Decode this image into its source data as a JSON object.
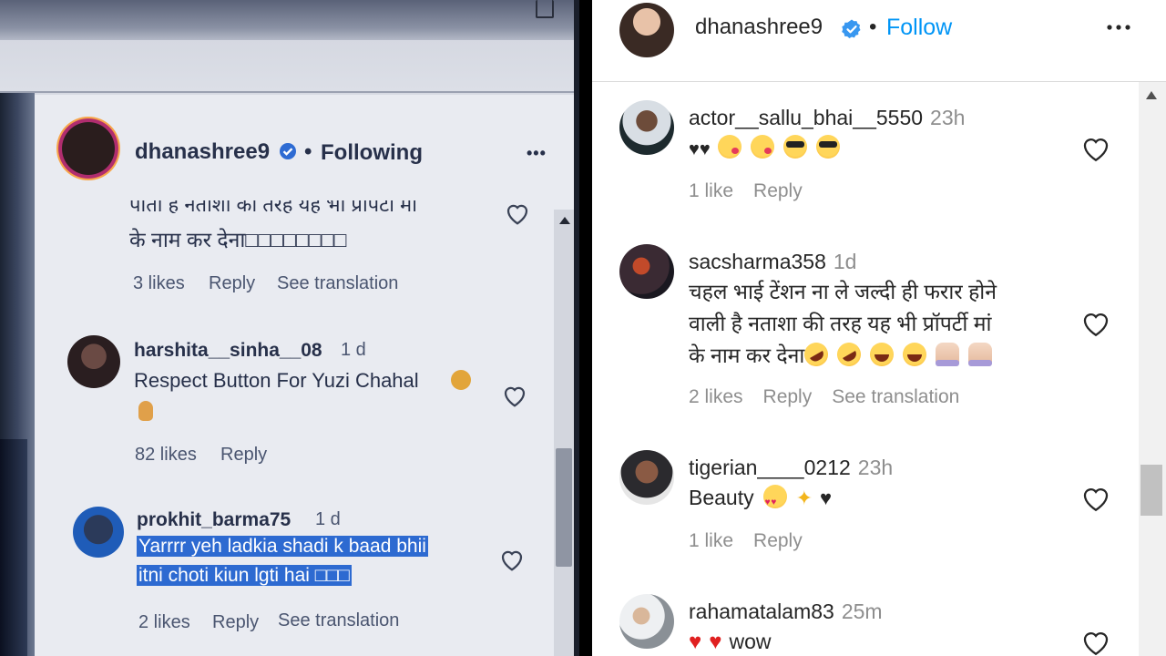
{
  "left_photo": {
    "header": {
      "username": "dhanashree9",
      "separator": "•",
      "following_label": "Following",
      "more": "•••"
    },
    "comments": [
      {
        "text_lines": [
          "पाता ह नताशा का तरह यह भा प्रापटा मा",
          "के नाम कर देना□□□□□□□□"
        ],
        "likes": "3 likes",
        "reply": "Reply",
        "see_translation": "See translation"
      },
      {
        "username": "harshita__sinha__08",
        "time": "1 d",
        "text_lines": [
          "Respect Button For Yuzi Chahal"
        ],
        "likes": "82 likes",
        "reply": "Reply"
      },
      {
        "username": "prokhit_barma75",
        "time": "1 d",
        "text_lines": [
          "Yarrrr yeh ladkia shadi k baad bhii",
          "itni choti kiun lgti hai □□□"
        ],
        "likes": "2 likes",
        "reply": "Reply",
        "see_translation": "See translation"
      }
    ]
  },
  "post": {
    "username": "dhanashree9",
    "dot": "•",
    "follow_label": "Follow"
  },
  "comments": [
    {
      "username": "actor__sallu_bhai__5550",
      "time": "23h",
      "text": "",
      "likes": "1 like",
      "reply": "Reply",
      "emojis": [
        "black-heart",
        "black-heart",
        "kiss",
        "kiss",
        "cool",
        "cool"
      ]
    },
    {
      "username": "sacsharma358",
      "time": "1d",
      "text_lines": [
        "चहल भाई टेंशन ना ले जल्दी ही फरार होने",
        "वाली है नताशा की तरह यह भी प्रॉपर्टी मां",
        "के नाम कर देना"
      ],
      "likes": "2 likes",
      "reply": "Reply",
      "see_translation": "See translation",
      "emojis": [
        "rofl",
        "rofl",
        "joy",
        "joy",
        "pray",
        "pray"
      ]
    },
    {
      "username": "tigerian____0212",
      "time": "23h",
      "text": "Beauty",
      "likes": "1 like",
      "reply": "Reply",
      "emojis": [
        "heart-eyes",
        "sparkles",
        "black-heart"
      ]
    },
    {
      "username": "rahamatalam83",
      "time": "25m",
      "text": "wow",
      "emojis": [
        "red-heart",
        "red-heart"
      ]
    }
  ],
  "colors": {
    "link_blue": "#0095f6",
    "verified_blue": "#3897f0",
    "meta_gray": "#8e8e8e",
    "text": "#262626",
    "highlight": "#2d6ad1"
  }
}
